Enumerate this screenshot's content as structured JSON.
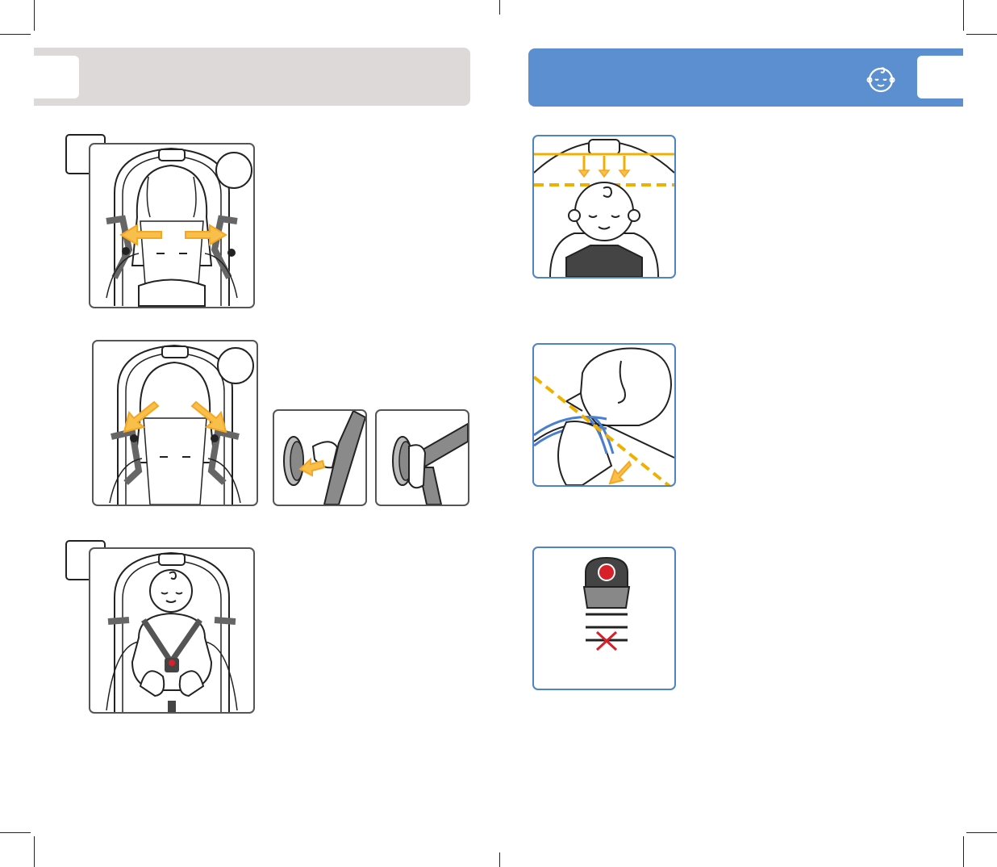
{
  "left_page": {
    "header": {
      "bg_color": "#dcd9d8",
      "tab_color": "#ffffff"
    },
    "illustrations": [
      "harness-straps-pulled-outward",
      "harness-straps-moved-to-sides",
      "clip-attaching-to-holder",
      "clip-attached-to-holder",
      "child-seated-and-buckled"
    ]
  },
  "right_page": {
    "header": {
      "bg_color": "#5b8fd0",
      "icon": "baby-face-icon"
    },
    "illustrations": [
      "shoulder-strap-height-check",
      "strap-tightness-pinch-test",
      "chest-clip-position-check"
    ]
  },
  "colors": {
    "arrow": "#f5a623",
    "guide_line": "#f0b000",
    "strap_blue": "#4a7fd0",
    "error_red": "#d8202a"
  }
}
